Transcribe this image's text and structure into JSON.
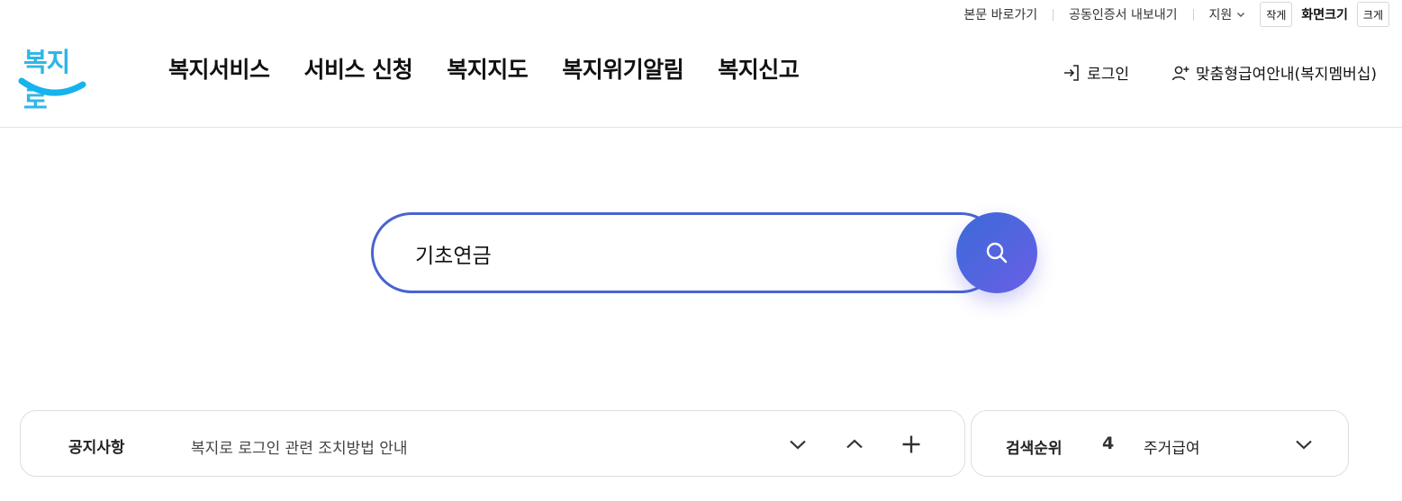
{
  "utility": {
    "skip_to_content": "본문 바로가기",
    "cert_export": "공동인증서 내보내기",
    "support": "지원",
    "size_smaller": "작게",
    "screen_size": "화면크기",
    "size_larger": "크게"
  },
  "logo": {
    "text": "복지로",
    "color": "#2fb6e9"
  },
  "gnb": [
    {
      "label": "복지서비스"
    },
    {
      "label": "서비스 신청"
    },
    {
      "label": "복지지도"
    },
    {
      "label": "복지위기알림"
    },
    {
      "label": "복지신고"
    }
  ],
  "header_right": {
    "login": "로그인",
    "custom_guide": "맞춤형급여안내(복지멤버십)"
  },
  "search": {
    "value": "기초연금",
    "border_color": "#4a63cf",
    "button_gradient": [
      "#3b6ad8",
      "#6a5fe6"
    ]
  },
  "notice": {
    "title": "공지사항",
    "text": "복지로 로그인 관련 조치방법 안내"
  },
  "ranking": {
    "title": "검색순위",
    "number": "4",
    "term": "주거급여"
  }
}
